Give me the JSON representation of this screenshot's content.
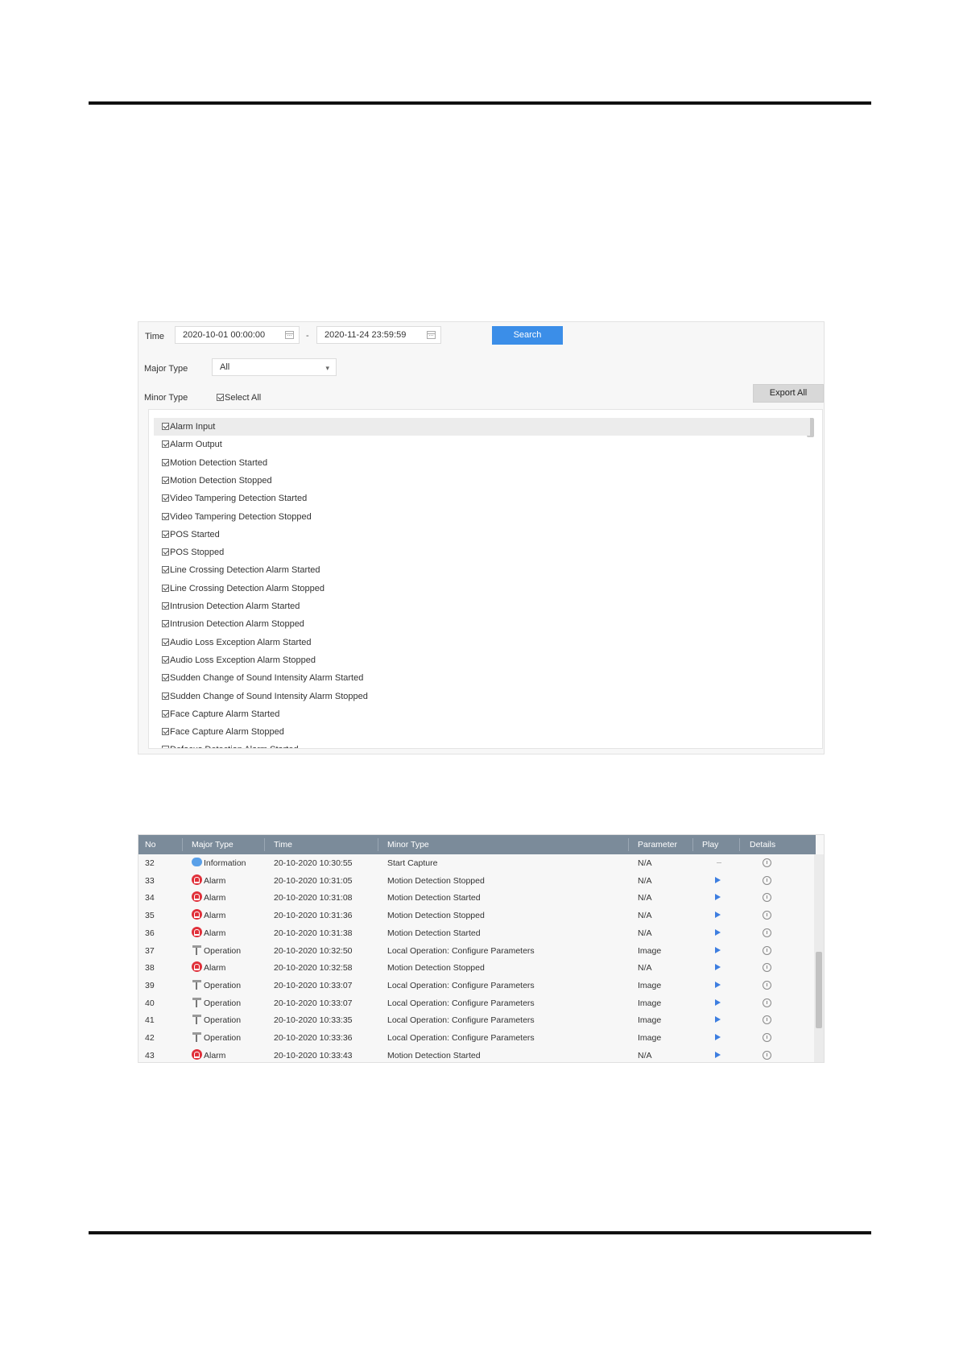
{
  "search": {
    "time_label": "Time",
    "start_time": "2020-10-01 00:00:00",
    "range_separator": "-",
    "end_time": "2020-11-24 23:59:59",
    "search_label": "Search",
    "major_type_label": "Major Type",
    "major_type_value": "All",
    "minor_type_label": "Minor Type",
    "select_all_label": "Select All",
    "export_all_label": "Export All"
  },
  "minor_types": [
    "Alarm Input",
    "Alarm Output",
    "Motion Detection Started",
    "Motion Detection Stopped",
    "Video Tampering Detection Started",
    "Video Tampering Detection Stopped",
    "POS Started",
    "POS Stopped",
    "Line Crossing Detection Alarm Started",
    "Line Crossing Detection Alarm Stopped",
    "Intrusion Detection Alarm Started",
    "Intrusion Detection Alarm Stopped",
    "Audio Loss Exception Alarm Started",
    "Audio Loss Exception Alarm Stopped",
    "Sudden Change of Sound Intensity Alarm Started",
    "Sudden Change of Sound Intensity Alarm Stopped",
    "Face Capture Alarm Started",
    "Face Capture Alarm Stopped",
    "Defocus Detection Alarm Started"
  ],
  "log_table": {
    "headers": [
      "No",
      "Major Type",
      "Time",
      "Minor Type",
      "Parameter",
      "Play",
      "Details"
    ],
    "rows": [
      {
        "no": "32",
        "icon": "information-icon",
        "major": "Information",
        "time": "20-10-2020 10:30:55",
        "minor": "Start Capture",
        "param": "N/A",
        "play": "none"
      },
      {
        "no": "33",
        "icon": "alarm-icon",
        "major": "Alarm",
        "time": "20-10-2020 10:31:05",
        "minor": "Motion Detection Stopped",
        "param": "N/A",
        "play": "play"
      },
      {
        "no": "34",
        "icon": "alarm-icon",
        "major": "Alarm",
        "time": "20-10-2020 10:31:08",
        "minor": "Motion Detection Started",
        "param": "N/A",
        "play": "play"
      },
      {
        "no": "35",
        "icon": "alarm-icon",
        "major": "Alarm",
        "time": "20-10-2020 10:31:36",
        "minor": "Motion Detection Stopped",
        "param": "N/A",
        "play": "play"
      },
      {
        "no": "36",
        "icon": "alarm-icon",
        "major": "Alarm",
        "time": "20-10-2020 10:31:38",
        "minor": "Motion Detection Started",
        "param": "N/A",
        "play": "play"
      },
      {
        "no": "37",
        "icon": "operation-icon",
        "major": "Operation",
        "time": "20-10-2020 10:32:50",
        "minor": "Local Operation: Configure Parameters",
        "param": "Image",
        "play": "play"
      },
      {
        "no": "38",
        "icon": "alarm-icon",
        "major": "Alarm",
        "time": "20-10-2020 10:32:58",
        "minor": "Motion Detection Stopped",
        "param": "N/A",
        "play": "play"
      },
      {
        "no": "39",
        "icon": "operation-icon",
        "major": "Operation",
        "time": "20-10-2020 10:33:07",
        "minor": "Local Operation: Configure Parameters",
        "param": "Image",
        "play": "play"
      },
      {
        "no": "40",
        "icon": "operation-icon",
        "major": "Operation",
        "time": "20-10-2020 10:33:07",
        "minor": "Local Operation: Configure Parameters",
        "param": "Image",
        "play": "play"
      },
      {
        "no": "41",
        "icon": "operation-icon",
        "major": "Operation",
        "time": "20-10-2020 10:33:35",
        "minor": "Local Operation: Configure Parameters",
        "param": "Image",
        "play": "play"
      },
      {
        "no": "42",
        "icon": "operation-icon",
        "major": "Operation",
        "time": "20-10-2020 10:33:36",
        "minor": "Local Operation: Configure Parameters",
        "param": "Image",
        "play": "play"
      },
      {
        "no": "43",
        "icon": "alarm-icon",
        "major": "Alarm",
        "time": "20-10-2020 10:33:43",
        "minor": "Motion Detection Started",
        "param": "N/A",
        "play": "play"
      }
    ]
  },
  "colors": {
    "search_button": "#3b8ee8",
    "table_header": "#7b8b9a",
    "alarm": "#e0303a",
    "information": "#5aa0e8",
    "play": "#3d7ee0"
  }
}
